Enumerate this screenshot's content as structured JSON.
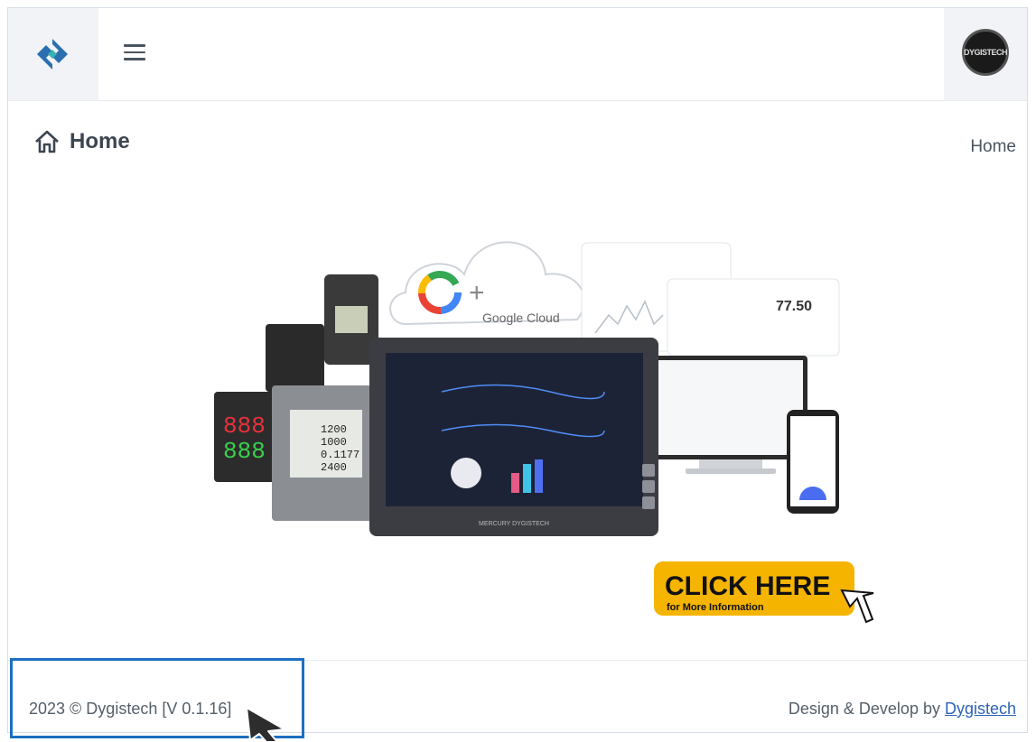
{
  "header": {
    "logo_icon": "dygistech-logo-icon",
    "menu_icon": "hamburger-icon",
    "avatar_text": "DYGISTECH"
  },
  "page": {
    "title": "Home",
    "title_icon": "home-icon",
    "breadcrumb": "Home"
  },
  "hero": {
    "cloud_text": "Google Cloud",
    "panel_value": "77.50",
    "device_label": "MERCURY DYGISTECH",
    "meter_values": [
      "888",
      "888"
    ],
    "lcd_values": [
      "1200",
      "1000",
      "0.1177",
      "2400"
    ],
    "cta_title": "CLICK HERE",
    "cta_subtitle": "for More Information"
  },
  "footer": {
    "copyright": "2023 © Dygistech [V 0.1.16]",
    "credit_prefix": "Design & Develop by ",
    "credit_link": "Dygistech"
  },
  "colors": {
    "accent_blue": "#1d6fc0",
    "link": "#2d63b8",
    "cta_yellow": "#f5b400",
    "logo_blue": "#2a6fb0",
    "logo_teal": "#37b4b0"
  }
}
